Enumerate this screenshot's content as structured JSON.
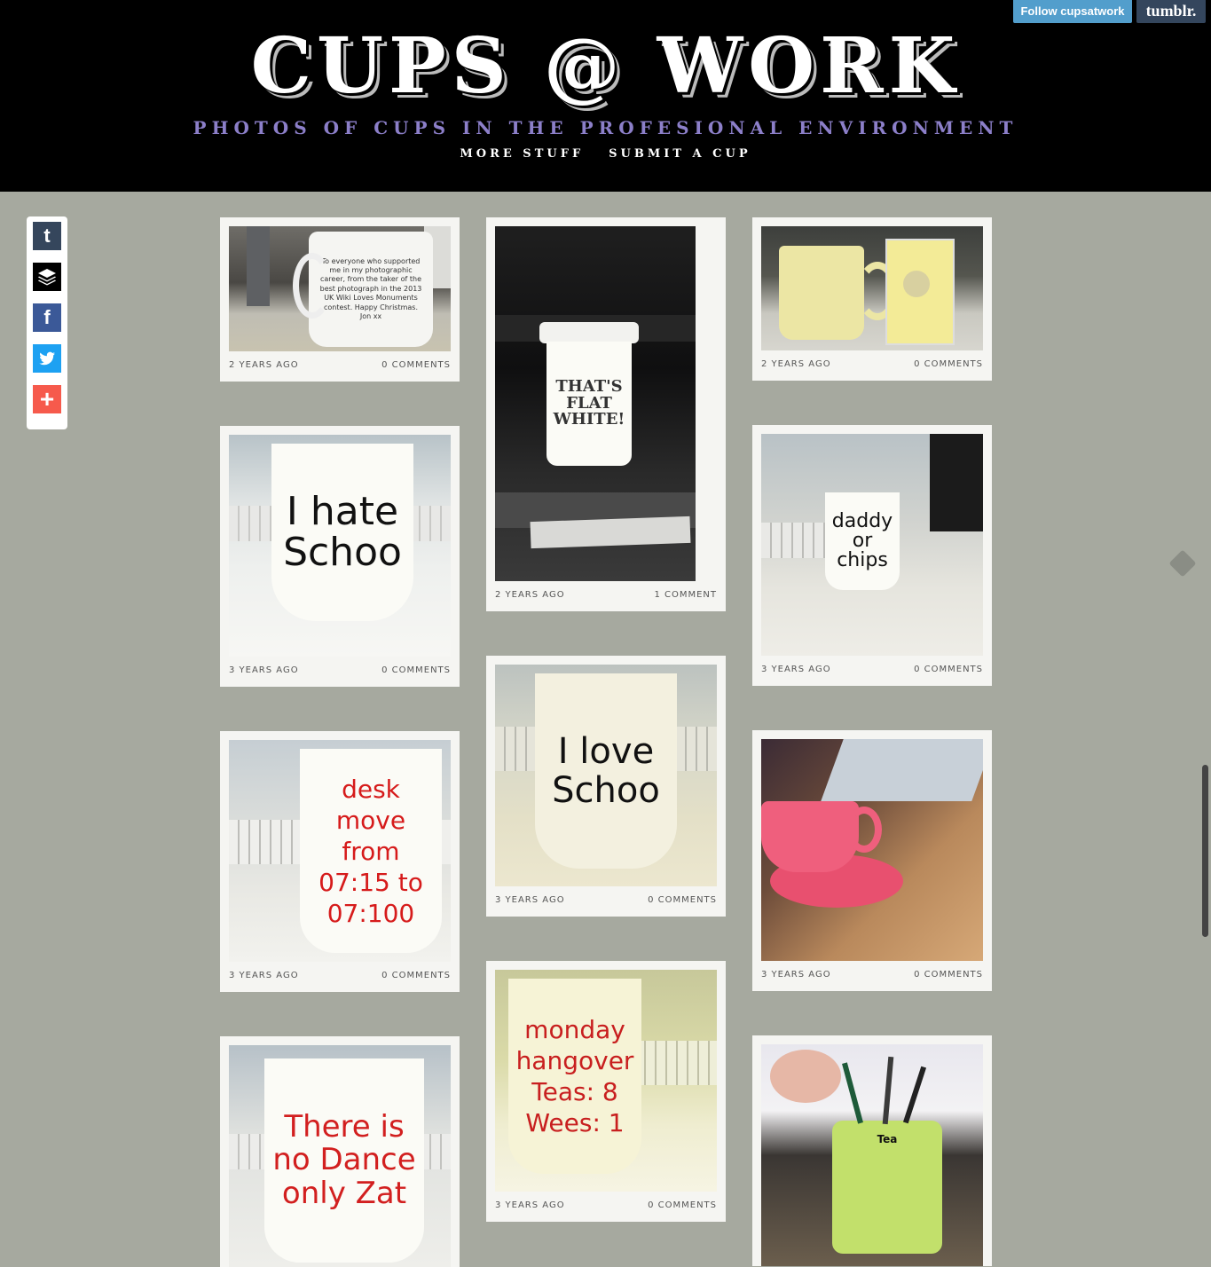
{
  "header": {
    "title": "CUPS @ WORK",
    "subtitle": "PHOTOS OF CUPS IN THE PROFESIONAL ENVIRONMENT",
    "nav": [
      "MORE STUFF",
      "SUBMIT A CUP"
    ]
  },
  "tumblr_bar": {
    "follow_label": "Follow cupsatwork",
    "logo": "tumblr."
  },
  "share_bar": {
    "icons": [
      "tumblr-icon",
      "buffer-icon",
      "facebook-icon",
      "twitter-icon",
      "add-icon"
    ]
  },
  "colors": {
    "background": "#a6a99f",
    "header": "#000000",
    "subtitle": "#8c7fc9",
    "follow": "#529ecc"
  },
  "posts": [
    {
      "age": "2 YEARS AGO",
      "comments": "0 COMMENTS",
      "cup_text": "To everyone who supported me in my photographic career, from the taker of the best photograph in the 2013 UK Wiki Loves Monuments contest. Happy Christmas. Jon xx"
    },
    {
      "age": "2 YEARS AGO",
      "comments": "1 COMMENT",
      "cup_text": "THAT'S FLAT WHITE!"
    },
    {
      "age": "2 YEARS AGO",
      "comments": "0 COMMENTS",
      "cup_text": ""
    },
    {
      "age": "3 YEARS AGO",
      "comments": "0 COMMENTS",
      "cup_text": "I hate Schoo"
    },
    {
      "age": "3 YEARS AGO",
      "comments": "0 COMMENTS",
      "cup_text": "daddy or chips"
    },
    {
      "age": "3 YEARS AGO",
      "comments": "0 COMMENTS",
      "cup_text": "I love Schoo"
    },
    {
      "age": "3 YEARS AGO",
      "comments": "0 COMMENTS",
      "cup_text": "desk move from 07:15 to 07:100"
    },
    {
      "age": "3 YEARS AGO",
      "comments": "0 COMMENTS",
      "cup_text": ""
    },
    {
      "age": "3 YEARS AGO",
      "comments": "0 COMMENTS",
      "cup_text": "monday hangover Teas: 8 Wees: 1"
    },
    {
      "age": "",
      "comments": "",
      "cup_text": "There is no Dance only Zat"
    },
    {
      "age": "",
      "comments": "",
      "cup_text": "Tea"
    }
  ]
}
